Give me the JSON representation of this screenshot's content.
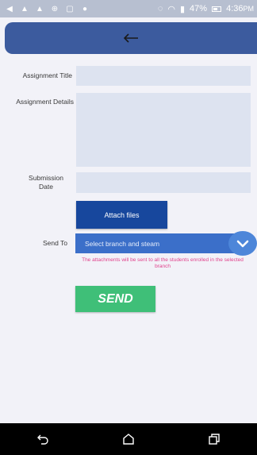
{
  "status_bar": {
    "battery": "47%",
    "time": "4:36",
    "ampm": "PM"
  },
  "form": {
    "assignment_title_label": "Assignment Title",
    "assignment_title_value": "",
    "assignment_details_label": "Assignment Details",
    "assignment_details_value": "",
    "submission_date_label": "Submission Date",
    "submission_date_value": "",
    "attach_files_label": "Attach files",
    "send_to_label": "Send To",
    "send_to_selected": "Select branch and steam",
    "note": "The attachments will be sent to all the  students enrolled in the selected branch",
    "send_label": "SEND"
  },
  "colors": {
    "app_bar": "#3c5b9e",
    "field_bg": "#dde3f0",
    "attach_button": "#17479d",
    "select_bg": "#3b6fc9",
    "note_text": "#e0428c",
    "send_button": "#3fbf78"
  },
  "icons": {
    "back": "left-arrow-icon",
    "dropdown": "chevron-down-icon",
    "nav_back": "nav-back-icon",
    "nav_home": "nav-home-icon",
    "nav_recents": "nav-recents-icon"
  }
}
